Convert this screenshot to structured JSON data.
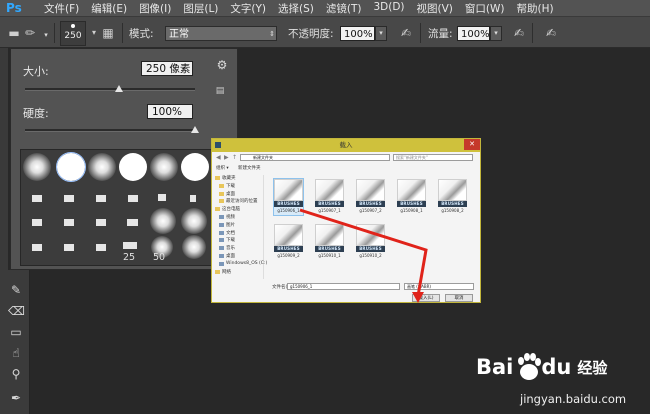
{
  "app": {
    "logo": "Ps"
  },
  "menu": [
    "文件(F)",
    "编辑(E)",
    "图像(I)",
    "图层(L)",
    "文字(Y)",
    "选择(S)",
    "滤镜(T)",
    "3D(D)",
    "视图(V)",
    "窗口(W)",
    "帮助(H)"
  ],
  "options_bar": {
    "brush_size": "250",
    "mode_label": "模式:",
    "mode_value": "正常",
    "opacity_label": "不透明度:",
    "opacity_value": "100%",
    "flow_label": "流量:",
    "flow_value": "100%"
  },
  "brush_panel": {
    "size_label": "大小:",
    "size_value": "250 像素",
    "size_fraction": 0.55,
    "hardness_label": "硬度:",
    "hardness_value": "100%",
    "hardness_fraction": 1.0,
    "preset_numbers": [
      "25",
      "50"
    ]
  },
  "dialog": {
    "title": "载入",
    "path": "新建文件夹",
    "search_placeholder": "搜索\"新建文件夹\"",
    "organize": "组织 ▾",
    "new_folder": "新建文件夹",
    "nav": [
      "收藏夹",
      "下载",
      "桌面",
      "最近访问的位置",
      "这台电脑",
      "视频",
      "图片",
      "文档",
      "下载",
      "音乐",
      "桌面",
      "Windows8_OS (C:)",
      "网络"
    ],
    "thumbnail_badge": "BRUSHES",
    "files": [
      "g150906_1",
      "g150907_1",
      "g150907_2",
      "g150908_1",
      "g150908_2",
      "g150909_2",
      "g150910_1",
      "g150910_2"
    ],
    "filename_label": "文件名(N):",
    "filename_value": "g150906_1",
    "filetype_value": "画笔 (*.ABR)",
    "load_button": "载入(L)",
    "cancel_button": "取消"
  },
  "watermark": {
    "logo_left": "Bai",
    "logo_right": "du",
    "logo_suffix": "经验",
    "url": "jingyan.baidu.com"
  },
  "colors": {
    "menubar": "#535353",
    "panel": "#535353",
    "canvas": "#282828",
    "dialog_title": "#cfc13c",
    "arrow": "#e0231a"
  }
}
